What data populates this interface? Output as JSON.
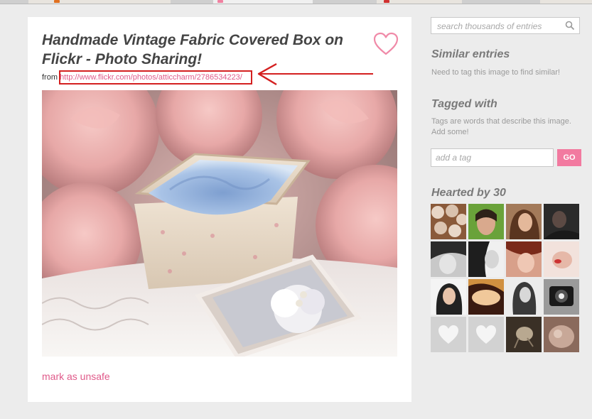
{
  "entry": {
    "title": "Handmade Vintage Fabric Covered Box on Flickr - Photo Sharing!",
    "from_label": "from",
    "source_url": "http://www.flickr.com/photos/atticcharm/2786534223/",
    "mark_unsafe_label": "mark as unsafe"
  },
  "sidebar": {
    "search_placeholder": "search thousands of entries",
    "similar": {
      "heading": "Similar entries",
      "text": "Need to tag this image to find similar!"
    },
    "tagged": {
      "heading": "Tagged with",
      "text": "Tags are words that describe this image. Add some!",
      "input_placeholder": "add a tag",
      "go_label": "GO"
    },
    "hearted": {
      "heading": "Hearted by 30"
    }
  },
  "colors": {
    "accent_pink": "#e05a8a",
    "go_button": "#f27aa0",
    "annotation_red": "#d42020"
  },
  "icons": [
    "heart-icon",
    "search-icon",
    "annotation-arrow"
  ]
}
